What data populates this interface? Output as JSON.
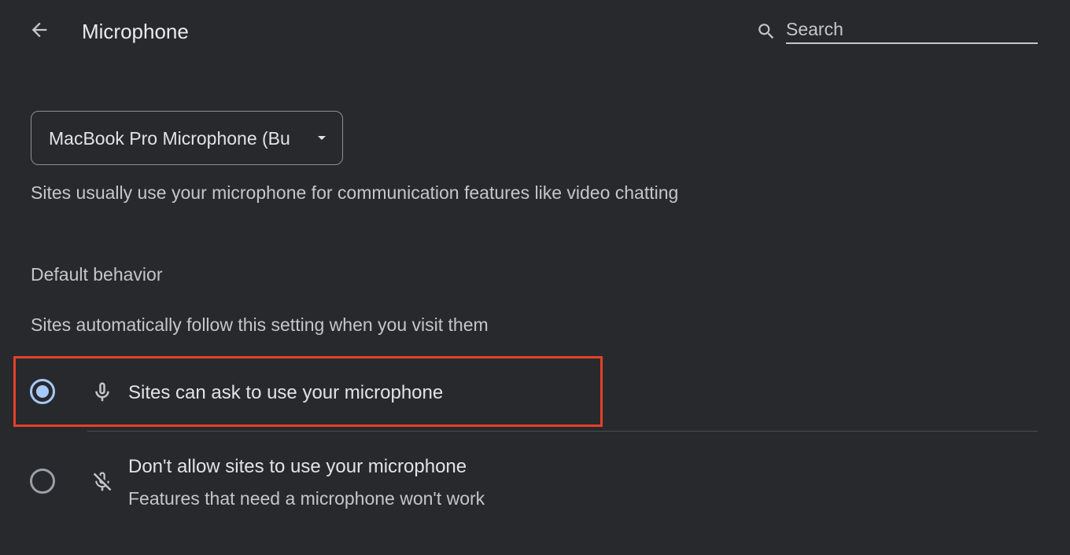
{
  "header": {
    "title": "Microphone",
    "back_icon": "arrow-left-icon",
    "search_icon": "search-icon",
    "search_placeholder": "Search",
    "search_value": ""
  },
  "device": {
    "selected": "MacBook Pro Microphone (Built-in)",
    "visible_text": "MacBook Pro Microphone (Bu"
  },
  "description": "Sites usually use your microphone for communication features like video chatting",
  "default_behavior": {
    "heading": "Default behavior",
    "subtitle": "Sites automatically follow this setting when you visit them",
    "options": [
      {
        "label": "Sites can ask to use your microphone",
        "sublabel": "",
        "icon": "microphone-icon",
        "selected": true
      },
      {
        "label": "Don't allow sites to use your microphone",
        "sublabel": "Features that need a microphone won't work",
        "icon": "microphone-off-icon",
        "selected": false
      }
    ]
  },
  "colors": {
    "background": "#28292d",
    "accent": "#a8c7fa",
    "highlight": "#e5402a"
  }
}
